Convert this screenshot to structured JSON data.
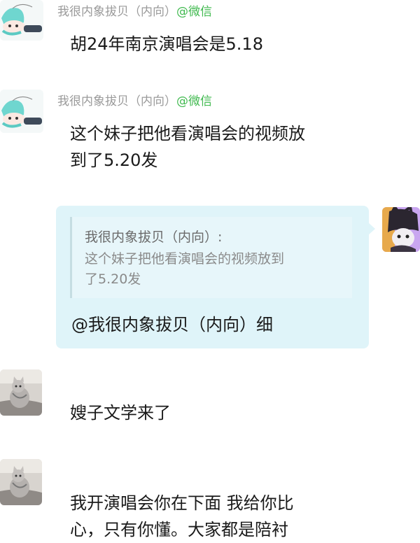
{
  "colors": {
    "sender_name": "#9a9a9a",
    "source_tag": "#3fb94e",
    "right_bubble": "#dff4f9",
    "quote_border": "#c5dde2"
  },
  "messages": [
    {
      "sender": "我很内象拔贝（内向）",
      "source": "@微信",
      "avatar_icon": "anime-girl-lying-icon",
      "text": "胡24年南京演唱会是5.18"
    },
    {
      "sender": "我很内象拔贝（内向）",
      "source": "@微信",
      "avatar_icon": "anime-girl-lying-icon",
      "text_line1": "这个妹子把他看演唱会的视频放",
      "text_line2": "到了5.20发"
    },
    {
      "self": true,
      "avatar_icon": "dark-cartoon-character-icon",
      "quote_author": "我很内象拔贝（内向）:",
      "quote_line1": "这个妹子把他看演唱会的视频放到",
      "quote_line2": "了5.20发",
      "reply_text": "@我很内象拔贝（内向）细"
    },
    {
      "avatar_icon": "cat-photo-icon",
      "text": "嫂子文学来了"
    },
    {
      "avatar_icon": "cat-photo-icon",
      "text_line1": "我开演唱会你在下面 我给你比",
      "text_line2": "心，只有你懂。大家都是陪衬"
    }
  ]
}
